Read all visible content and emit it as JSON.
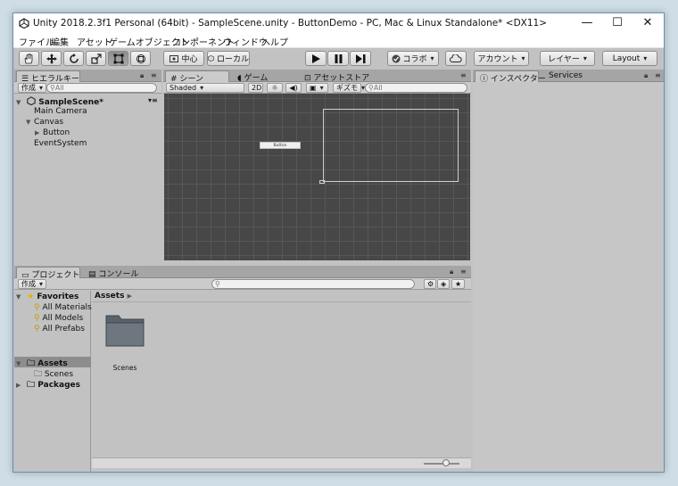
{
  "window": {
    "title": "Unity 2018.2.3f1 Personal (64bit) - SampleScene.unity - ButtonDemo - PC, Mac & Linux Standalone* <DX11>",
    "minimize_glyph": "—",
    "maximize_glyph": "☐",
    "close_glyph": "✕"
  },
  "menu": [
    "ファイル",
    "編集",
    "アセット",
    "ゲームオブジェクト",
    "コンポーネント",
    "ウィンドウ",
    "ヘルプ"
  ],
  "toolbar": {
    "pivot_label": "中心",
    "space_label": "ローカル",
    "collab_label": "コラボ",
    "account_label": "アカウント",
    "layers_label": "レイヤー",
    "layout_label": "Layout"
  },
  "hierarchy": {
    "tab_label": "ヒエラルキー",
    "create_label": "作成",
    "search_placeholder": "All",
    "scene_name": "SampleScene*",
    "items": [
      "Main Camera",
      "Canvas",
      "Button",
      "EventSystem"
    ]
  },
  "scene_tabs": {
    "scene_label": "シーン",
    "game_label": "ゲーム",
    "store_label": "アセットストア"
  },
  "scene_toolbar": {
    "shading_mode": "Shaded",
    "mode_2d": "2D",
    "gizmos_label": "ギズモ",
    "search_placeholder": "All",
    "button_text": "Button"
  },
  "inspector": {
    "tab_label": "インスペクター",
    "services_label": "Services"
  },
  "project": {
    "tab_label": "プロジェクト",
    "console_label": "コンソール",
    "create_label": "作成",
    "favorites_label": "Favorites",
    "favorites": [
      "All Materials",
      "All Models",
      "All Prefabs"
    ],
    "assets_label": "Assets",
    "scenes_label": "Scenes",
    "packages_label": "Packages",
    "breadcrumb": "Assets",
    "grid_items": [
      "Scenes"
    ]
  },
  "colors": {
    "scene_bg": "#474747",
    "selection": "#8d8d8d",
    "panel_bg": "#c2c2c2"
  }
}
